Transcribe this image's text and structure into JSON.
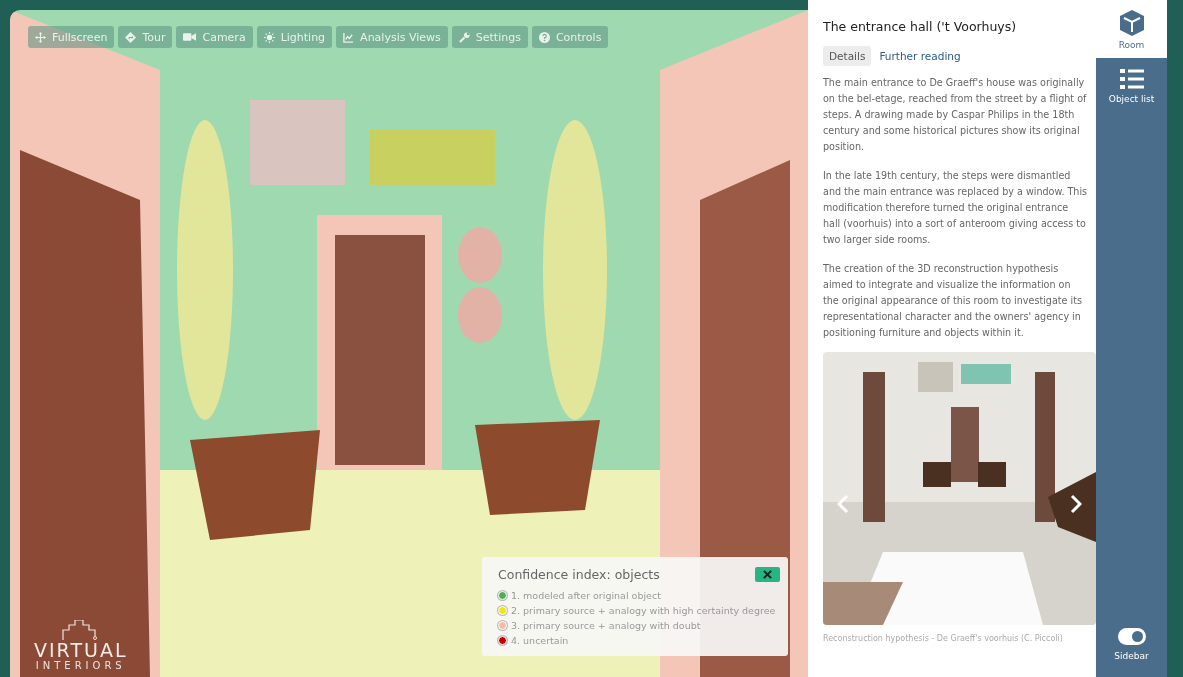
{
  "toolbar": [
    {
      "kind": "move",
      "label": "Fullscreen"
    },
    {
      "kind": "tour",
      "label": "Tour"
    },
    {
      "kind": "camera",
      "label": "Camera"
    },
    {
      "kind": "light",
      "label": "Lighting"
    },
    {
      "kind": "chart",
      "label": "Analysis Views"
    },
    {
      "kind": "wrench",
      "label": "Settings"
    },
    {
      "kind": "help",
      "label": "Controls"
    }
  ],
  "logo": {
    "line_1": "VIRTUAL",
    "line_2": "INTERIORS"
  },
  "legend": {
    "title": "Confidence index: objects",
    "items": [
      {
        "label": "1. modeled after original object",
        "color": "#4caf50"
      },
      {
        "label": "2. primary source + analogy with high certainty degree",
        "color": "#e8e81a"
      },
      {
        "label": "3. primary source + analogy with doubt",
        "color": "#f6bca6"
      },
      {
        "label": "4. uncertain",
        "color": "#c40000"
      }
    ]
  },
  "panel": {
    "title": "The entrance hall ('t Voorhuys)",
    "tabs": [
      {
        "label": "Details",
        "selected": true
      },
      {
        "label": "Further reading",
        "selected": false
      }
    ],
    "paragraphs": [
      "The main entrance to De Graeff's house was originally on the bel-etage, reached from the street by a flight of steps. A drawing made by Caspar Philips in the 18th century and some historical pictures show its original position.",
      "In the late 19th century, the steps were dismantled and the main entrance was replaced by a window. This modification therefore turned the original entrance hall (voorhuis) into a sort of anteroom giving access to two larger side rooms.",
      "The creation of the 3D reconstruction hypothesis aimed to integrate and visualize the information on the original appearance of this room to investigate its representational character and the owners' agency in positioning furniture and objects within it."
    ],
    "caption": "Reconstruction hypothesis - De Graeff's voorhuis (C. Piccoli)"
  },
  "sidebar": {
    "items": [
      {
        "kind": "cube",
        "label": "Room",
        "selected": true
      },
      {
        "kind": "list",
        "label": "Object list",
        "selected": false
      }
    ],
    "toggle": {
      "label": "Sidebar",
      "on": true
    }
  }
}
